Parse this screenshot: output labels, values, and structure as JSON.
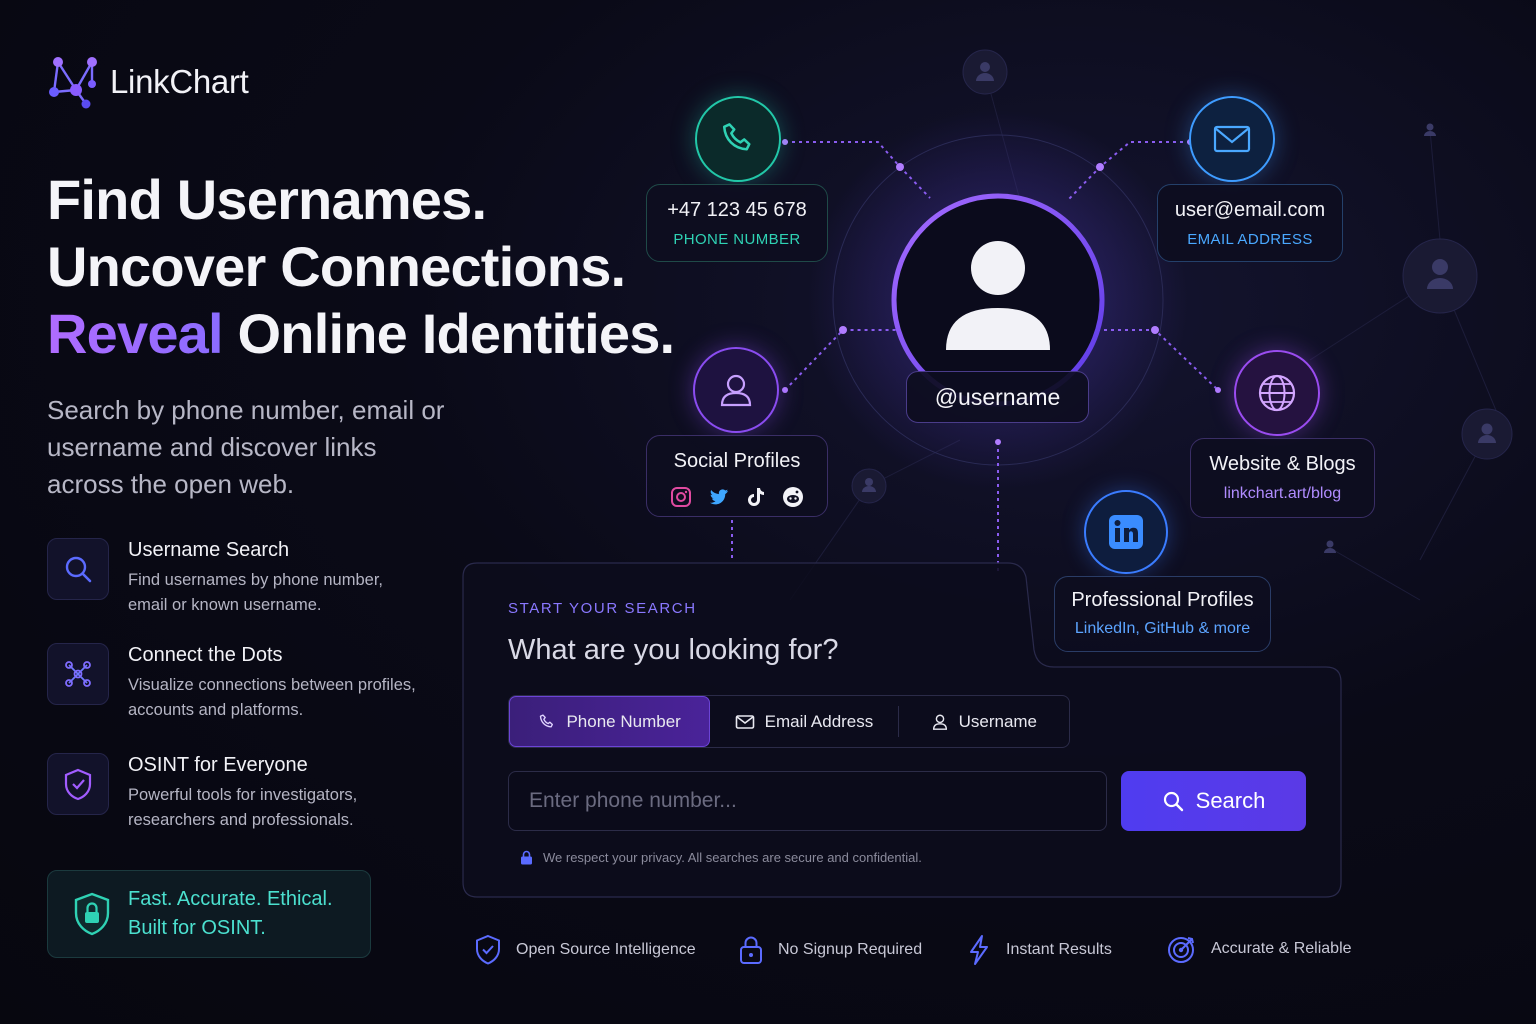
{
  "brand": {
    "name": "LinkChart"
  },
  "hero": {
    "line1": "Find Usernames.",
    "line2": "Uncover Connections.",
    "line3_accent": "Reveal",
    "line3_rest": " Online Identities.",
    "subtitle": "Search by phone number, email or username and discover links across the open web."
  },
  "features": [
    {
      "title": "Username Search",
      "desc": "Find usernames by phone number, email or known username.",
      "icon": "search-icon"
    },
    {
      "title": "Connect the Dots",
      "desc": "Visualize connections between profiles, accounts and platforms.",
      "icon": "network-icon"
    },
    {
      "title": "OSINT for Everyone",
      "desc": "Powerful tools for investigators, researchers and professionals.",
      "icon": "shield-icon"
    }
  ],
  "ethic": {
    "line1": "Fast. Accurate. Ethical.",
    "line2": "Built for OSINT."
  },
  "network": {
    "center_label": "@username",
    "phone": {
      "value": "+47 123 45 678",
      "label": "PHONE NUMBER"
    },
    "email": {
      "value": "user@email.com",
      "label": "EMAIL ADDRESS"
    },
    "social": {
      "title": "Social Profiles",
      "icons": [
        "instagram-icon",
        "twitter-icon",
        "tiktok-icon",
        "reddit-icon"
      ]
    },
    "website": {
      "title": "Website & Blogs",
      "sub": "linkchart.art/blog"
    },
    "professional": {
      "title": "Professional Profiles",
      "sub": "LinkedIn, GitHub & more"
    }
  },
  "search_panel": {
    "eyebrow": "START YOUR SEARCH",
    "title": "What are you looking for?",
    "tabs": [
      {
        "label": "Phone Number",
        "icon": "phone-icon",
        "active": true
      },
      {
        "label": "Email Address",
        "icon": "mail-icon",
        "active": false
      },
      {
        "label": "Username",
        "icon": "user-icon",
        "active": false
      }
    ],
    "input_placeholder": "Enter phone number...",
    "search_label": "Search",
    "privacy": "We respect your privacy. All searches are secure and confidential."
  },
  "footer": [
    {
      "label": "Open Source Intelligence",
      "icon": "shield-check-icon"
    },
    {
      "label": "No Signup Required",
      "icon": "lock-icon"
    },
    {
      "label": "Instant Results",
      "icon": "bolt-icon"
    },
    {
      "label": "Accurate & Reliable",
      "icon": "target-icon"
    }
  ],
  "colors": {
    "accent": "#8a6cff",
    "teal": "#2fd2b4",
    "blue": "#4aa8ff",
    "purple": "#a855f7",
    "button": "#5140ee"
  }
}
